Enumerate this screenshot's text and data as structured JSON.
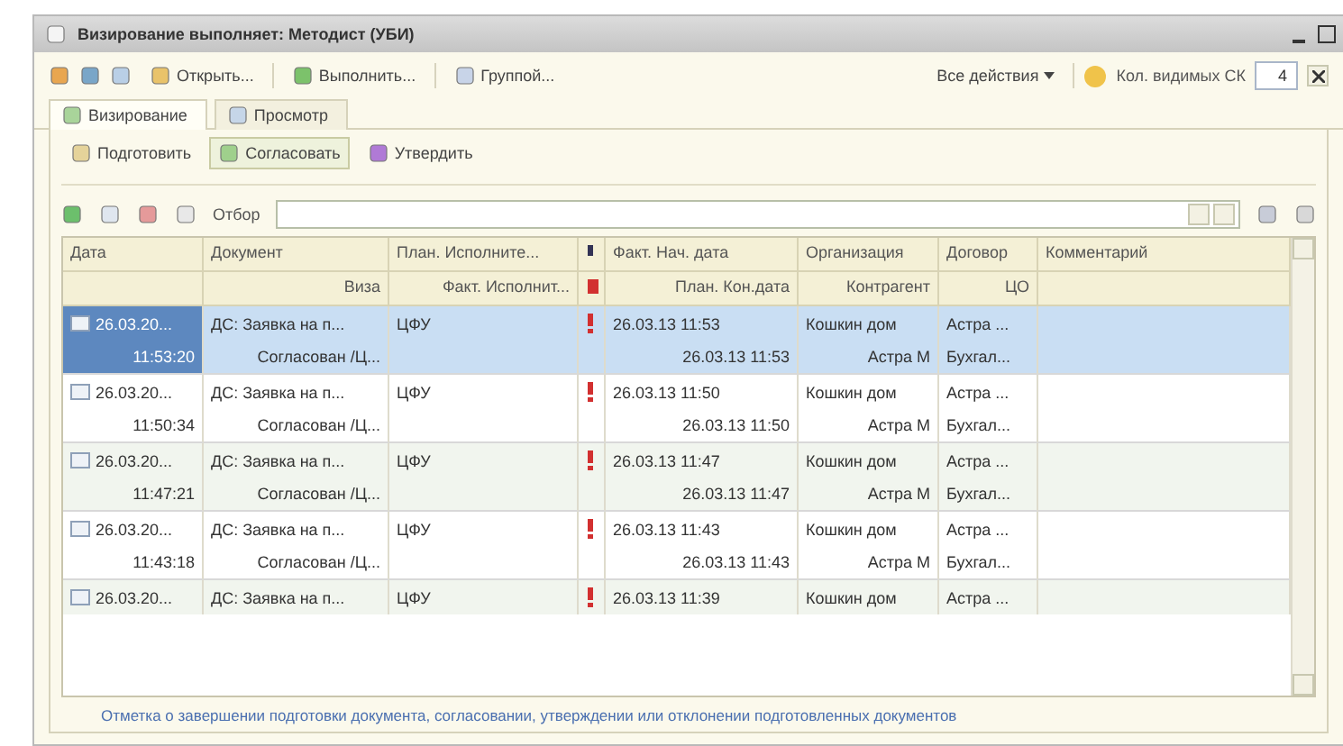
{
  "window": {
    "title": "Визирование выполняет: Методист (УБИ)"
  },
  "toolbar": {
    "buttons": [
      {
        "label": "Открыть..."
      },
      {
        "label": "Выполнить..."
      },
      {
        "label": "Группой..."
      }
    ],
    "all_actions": "Все действия",
    "visible_label": "Кол. видимых СК",
    "visible_value": "4"
  },
  "tabs": [
    {
      "label": "Визирование",
      "selected": true
    },
    {
      "label": "Просмотр",
      "selected": false
    }
  ],
  "actions": [
    {
      "label": "Подготовить",
      "selected": false
    },
    {
      "label": "Согласовать",
      "selected": true
    },
    {
      "label": "Утвердить",
      "selected": false
    }
  ],
  "filter": {
    "label": "Отбор"
  },
  "columns": [
    {
      "top": "Дата"
    },
    {
      "top": "Документ",
      "bottom": "Виза"
    },
    {
      "top": "План. Исполните...",
      "bottom": "Факт. Исполнит..."
    },
    {},
    {
      "top": "Факт. Нач. дата",
      "bottom": "План. Кон.дата"
    },
    {
      "top": "Организация",
      "bottom": "Контрагент"
    },
    {
      "top": "Договор",
      "bottom": "ЦО"
    },
    {
      "top": "Комментарий"
    }
  ],
  "rows": [
    {
      "selected": true,
      "important": true,
      "date": "26.03.20...",
      "time": "11:53:20",
      "document": "ДС: Заявка на п...",
      "visa": "Согласован /Ц...",
      "plan_executor": "ЦФУ",
      "fact_start": "26.03.13 11:53",
      "plan_end": "26.03.13 11:53",
      "organization": "Кошкин дом",
      "counterparty": "Астра М",
      "contract": "Астра ...",
      "cfo": "Бухгал..."
    },
    {
      "selected": false,
      "important": true,
      "date": "26.03.20...",
      "time": "11:50:34",
      "document": "ДС: Заявка на п...",
      "visa": "Согласован /Ц...",
      "plan_executor": "ЦФУ",
      "fact_start": "26.03.13 11:50",
      "plan_end": "26.03.13 11:50",
      "organization": "Кошкин дом",
      "counterparty": "Астра М",
      "contract": "Астра ...",
      "cfo": "Бухгал..."
    },
    {
      "selected": false,
      "important": true,
      "date": "26.03.20...",
      "time": "11:47:21",
      "document": "ДС: Заявка на п...",
      "visa": "Согласован /Ц...",
      "plan_executor": "ЦФУ",
      "fact_start": "26.03.13 11:47",
      "plan_end": "26.03.13 11:47",
      "organization": "Кошкин дом",
      "counterparty": "Астра М",
      "contract": "Астра ...",
      "cfo": "Бухгал..."
    },
    {
      "selected": false,
      "important": true,
      "date": "26.03.20...",
      "time": "11:43:18",
      "document": "ДС: Заявка на п...",
      "visa": "Согласован /Ц...",
      "plan_executor": "ЦФУ",
      "fact_start": "26.03.13 11:43",
      "plan_end": "26.03.13 11:43",
      "organization": "Кошкин дом",
      "counterparty": "Астра М",
      "contract": "Астра ...",
      "cfo": "Бухгал..."
    },
    {
      "selected": false,
      "important": true,
      "date": "26.03.20...",
      "document": "ДС: Заявка на п...",
      "plan_executor": "ЦФУ",
      "fact_start": "26.03.13 11:39",
      "organization": "Кошкин дом",
      "contract": "Астра ..."
    }
  ],
  "footer": "Отметка о завершении подготовки документа, согласовании, утверждении или отклонении подготовленных документов"
}
